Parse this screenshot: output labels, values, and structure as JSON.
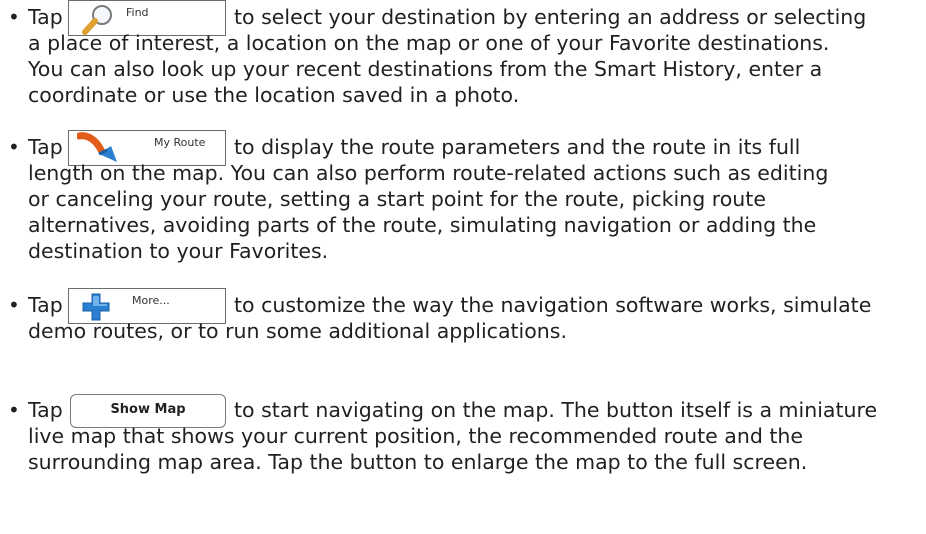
{
  "items": [
    {
      "tap": "Tap",
      "button_label": "Find",
      "button_icon": "magnifier-icon",
      "lines": [
        "to select your destination by entering an address or selecting",
        "a place of interest, a location on the map or one of your Favorite destinations.",
        "You can also look up your recent destinations from the Smart History, enter a",
        "coordinate or use the location saved in a photo."
      ]
    },
    {
      "tap": "Tap",
      "button_label": "My Route",
      "button_icon": "route-arrow-icon",
      "lines": [
        "to display the route parameters and the route in its full",
        "length on the map. You can also perform route-related actions such as editing",
        "or canceling your route, setting a start point for the route, picking route",
        "alternatives, avoiding parts of the route, simulating navigation or adding the",
        "destination to your Favorites."
      ]
    },
    {
      "tap": "Tap",
      "button_label": "More...",
      "button_icon": "plus-icon",
      "lines": [
        "to customize the way the navigation software works, simulate",
        "demo routes, or to run some additional applications."
      ]
    },
    {
      "tap": "Tap",
      "button_label": "Show Map",
      "lines": [
        "to start navigating on the map. The button itself is a miniature",
        "live map that shows your current position, the recommended route and the",
        "surrounding map area. Tap the button to enlarge the map to the full screen."
      ]
    }
  ],
  "colors": {
    "text": "#231f20",
    "icon_blue": "#2a7fd0",
    "icon_orange": "#e25c1a"
  }
}
